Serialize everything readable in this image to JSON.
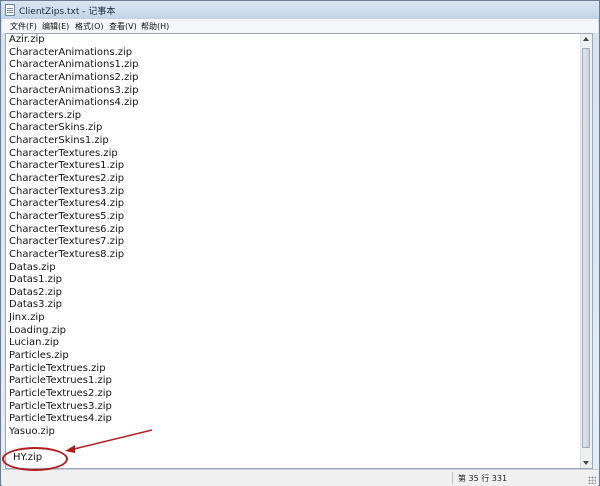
{
  "window": {
    "title": "ClientZips.txt - 记事本"
  },
  "menu": [
    "文件(F)",
    "编辑(E)",
    "格式(O)",
    "查看(V)",
    "帮助(H)"
  ],
  "editor": {
    "lines": [
      "Azir.zip",
      "CharacterAnimations.zip",
      "CharacterAnimations1.zip",
      "CharacterAnimations2.zip",
      "CharacterAnimations3.zip",
      "CharacterAnimations4.zip",
      "Characters.zip",
      "CharacterSkins.zip",
      "CharacterSkins1.zip",
      "CharacterTextures.zip",
      "CharacterTextures1.zip",
      "CharacterTextures2.zip",
      "CharacterTextures3.zip",
      "CharacterTextures4.zip",
      "CharacterTextures5.zip",
      "CharacterTextures6.zip",
      "CharacterTextures7.zip",
      "CharacterTextures8.zip",
      "Datas.zip",
      "Datas1.zip",
      "Datas2.zip",
      "Datas3.zip",
      "Jinx.zip",
      "Loading.zip",
      "Lucian.zip",
      "Particles.zip",
      "ParticleTextrues.zip",
      "ParticleTextrues1.zip",
      "ParticleTextrues2.zip",
      "ParticleTextrues3.zip",
      "ParticleTextrues4.zip",
      "Yasuo.zip"
    ],
    "highlighted_line": "HY.zip"
  },
  "status": {
    "position": "第 35 行 331"
  },
  "annotation": {
    "color": "#b21c1c"
  }
}
